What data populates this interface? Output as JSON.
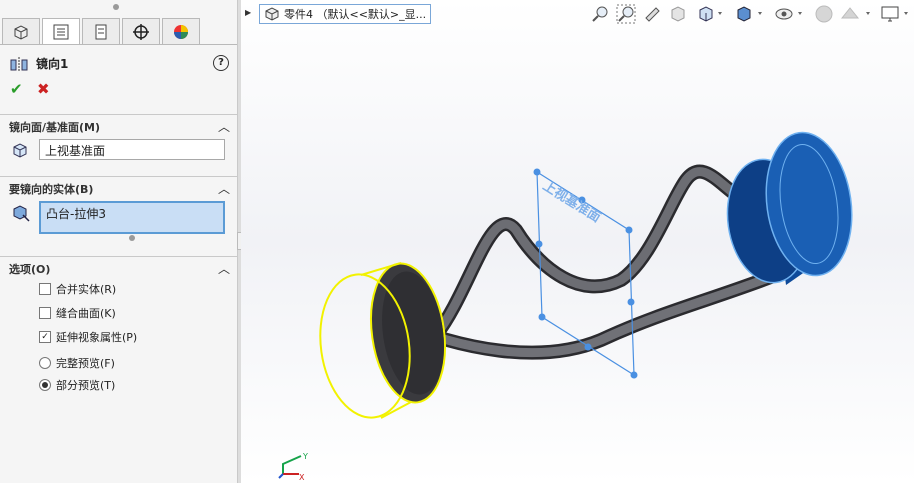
{
  "feature": {
    "title": "镜向1",
    "help_glyph": "?",
    "ok_glyph": "✔",
    "cancel_glyph": "✖"
  },
  "tabs": [
    {
      "name": "feature-manager",
      "icon": "cube-icon"
    },
    {
      "name": "property-manager",
      "icon": "list-icon"
    },
    {
      "name": "configuration-manager",
      "icon": "config-icon"
    },
    {
      "name": "dimxpert-manager",
      "icon": "crosshair-icon"
    },
    {
      "name": "display-manager",
      "icon": "color-wheel-icon"
    }
  ],
  "mirror_face": {
    "header": "镜向面/基准面(M)",
    "value": "上视基准面"
  },
  "bodies": {
    "header": "要镜向的实体(B)",
    "value": "凸台-拉伸3"
  },
  "options": {
    "header": "选项(O)",
    "merge_label": "合并实体(R)",
    "merge_checked": false,
    "knit_label": "缝合曲面(K)",
    "knit_checked": false,
    "propagate_label": "延伸视象属性(P)",
    "propagate_checked": true,
    "full_preview_label": "完整预览(F)",
    "partial_preview_label": "部分预览(T)",
    "preview_selected": "partial"
  },
  "tree": {
    "label": "零件4 （默认<<默认>_显..."
  },
  "view_toolbar": [
    "zoom-to-fit-icon",
    "zoom-to-area-icon",
    "previous-view-icon",
    "section-view-icon",
    "view-orientation-icon",
    "display-style-icon",
    "hide-show-icon",
    "edit-appearance-icon",
    "apply-scene-icon",
    "view-settings-icon"
  ],
  "plane_label": "上视基准面",
  "colors": {
    "plane": "#4a90e2",
    "preview": "#f2f200",
    "body_dark": "#3a3a3e",
    "body_blue": "#1a5fb4",
    "check": "#2a9d2a",
    "cancel": "#cc2222"
  }
}
